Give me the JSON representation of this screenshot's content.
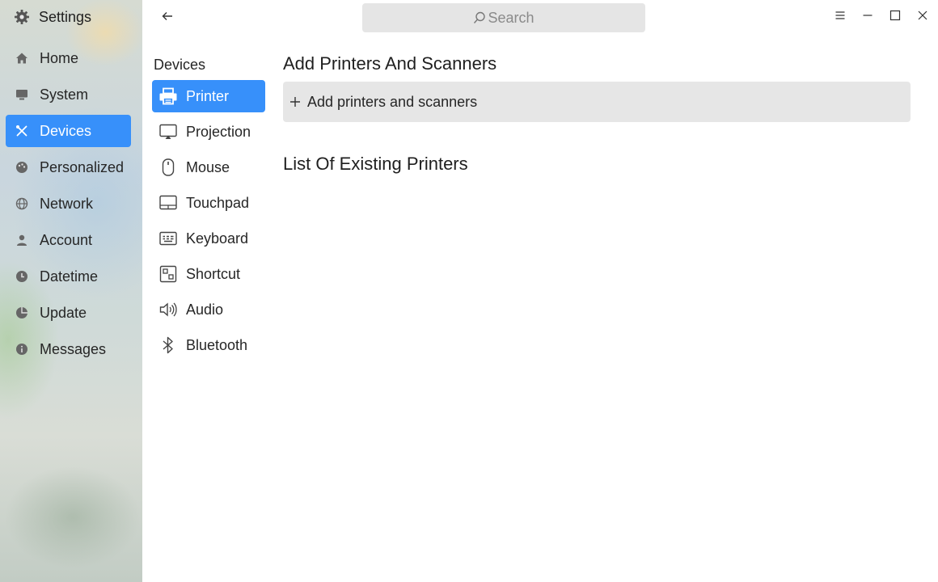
{
  "app": {
    "title": "Settings",
    "icon": "gear-icon"
  },
  "sidebar": {
    "items": [
      {
        "label": "Home",
        "icon": "home-icon",
        "active": false
      },
      {
        "label": "System",
        "icon": "monitor-icon",
        "active": false
      },
      {
        "label": "Devices",
        "icon": "tools-icon",
        "active": true
      },
      {
        "label": "Personalized",
        "icon": "palette-icon",
        "active": false
      },
      {
        "label": "Network",
        "icon": "globe-icon",
        "active": false
      },
      {
        "label": "Account",
        "icon": "user-icon",
        "active": false
      },
      {
        "label": "Datetime",
        "icon": "clock-icon",
        "active": false
      },
      {
        "label": "Update",
        "icon": "update-icon",
        "active": false
      },
      {
        "label": "Messages",
        "icon": "info-icon",
        "active": false
      }
    ]
  },
  "topbar": {
    "search_placeholder": "Search",
    "controls": [
      "menu-icon",
      "minimize-icon",
      "maximize-icon",
      "close-icon"
    ]
  },
  "subnav": {
    "title": "Devices",
    "items": [
      {
        "label": "Printer",
        "icon": "printer-icon",
        "active": true
      },
      {
        "label": "Projection",
        "icon": "projection-icon",
        "active": false
      },
      {
        "label": "Mouse",
        "icon": "mouse-icon",
        "active": false
      },
      {
        "label": "Touchpad",
        "icon": "touchpad-icon",
        "active": false
      },
      {
        "label": "Keyboard",
        "icon": "keyboard-icon",
        "active": false
      },
      {
        "label": "Shortcut",
        "icon": "shortcut-icon",
        "active": false
      },
      {
        "label": "Audio",
        "icon": "speaker-icon",
        "active": false
      },
      {
        "label": "Bluetooth",
        "icon": "bluetooth-icon",
        "active": false
      }
    ]
  },
  "main": {
    "add_heading": "Add Printers And Scanners",
    "add_button_label": "Add printers and scanners",
    "list_heading": "List Of Existing Printers"
  },
  "colors": {
    "accent": "#3790fa",
    "row_bg": "#e6e6e6",
    "search_bg": "#e5e5e5"
  }
}
